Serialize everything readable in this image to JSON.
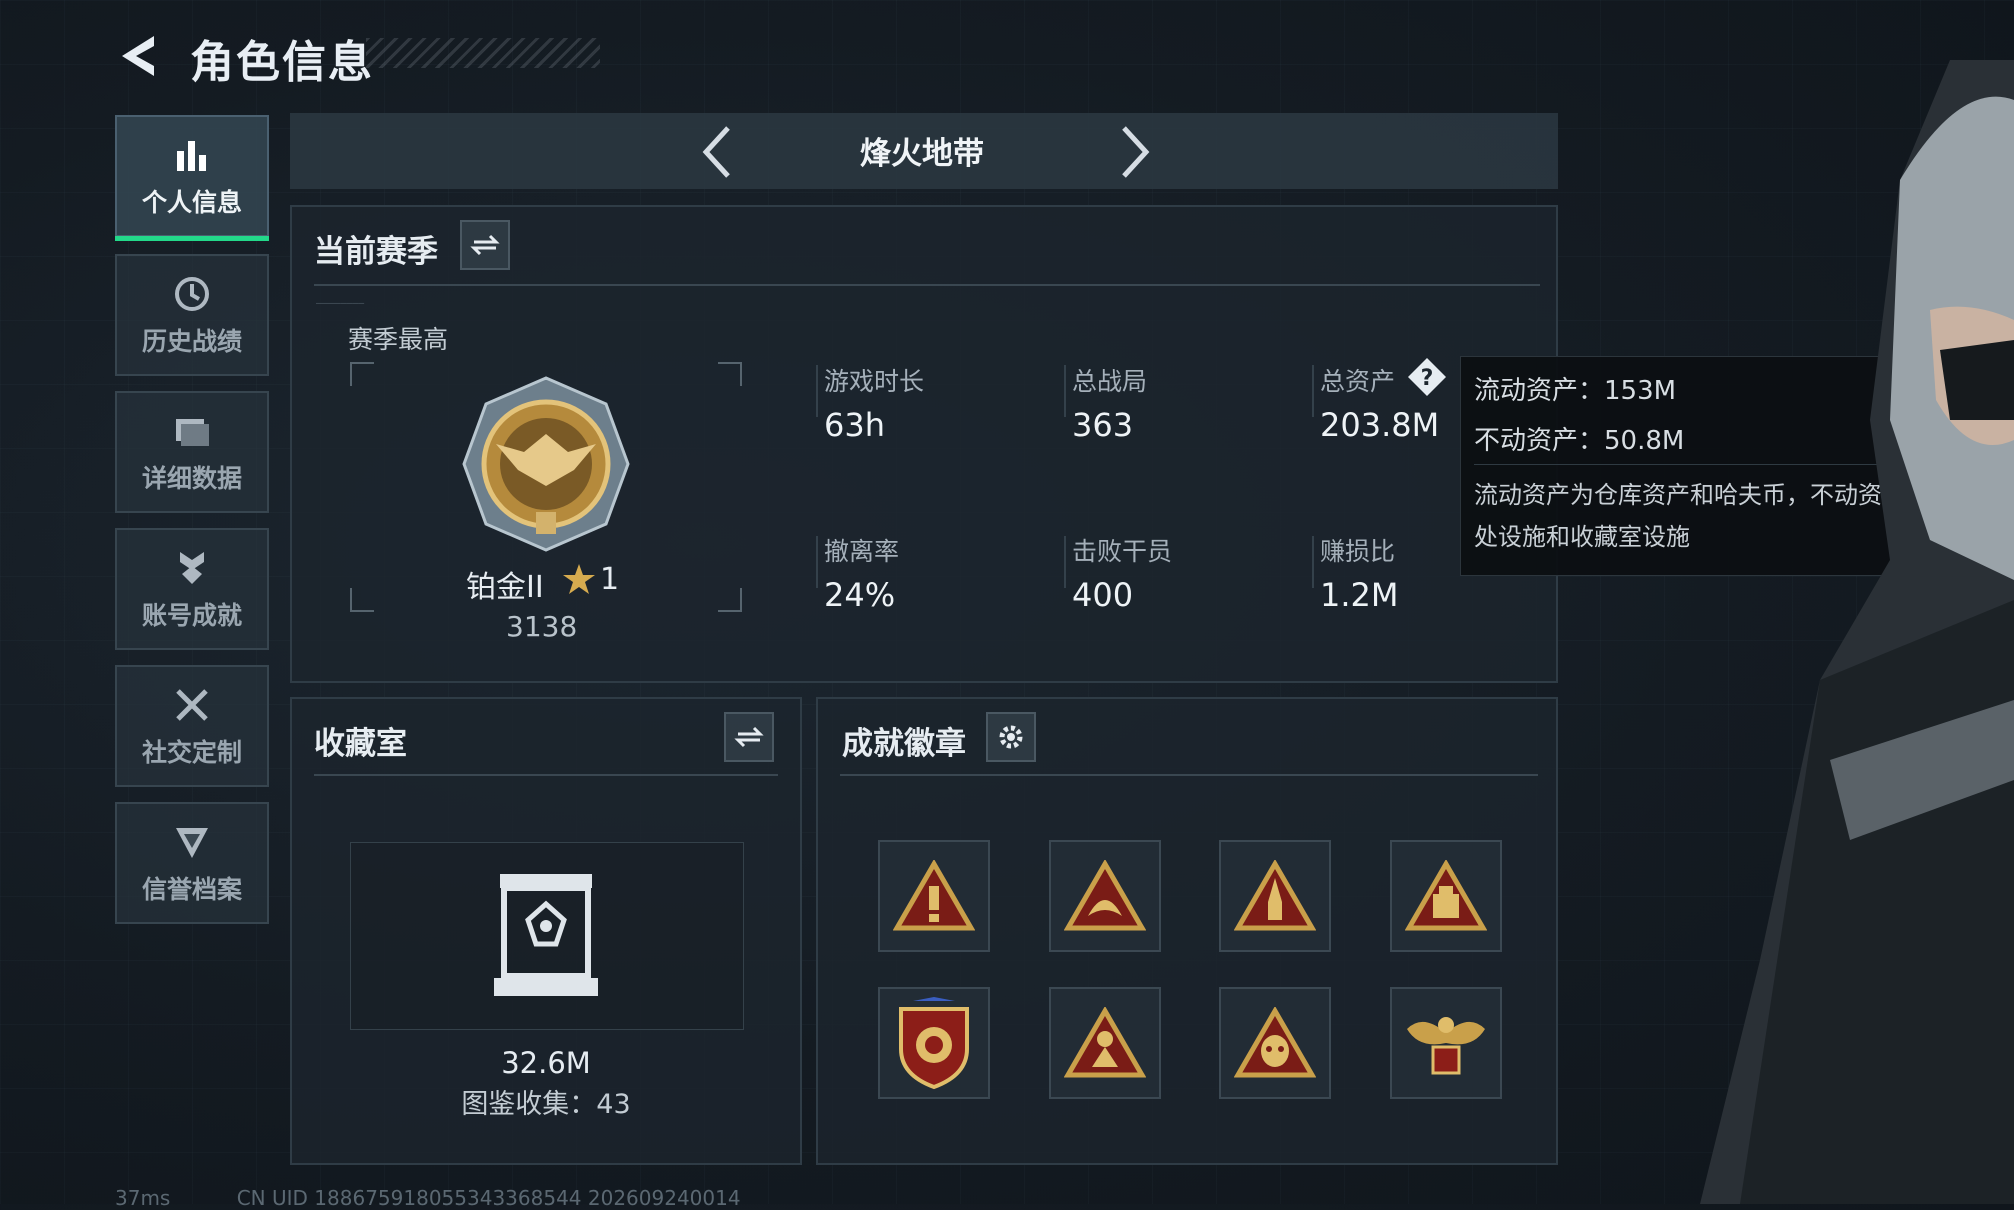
{
  "header": {
    "title": "角色信息"
  },
  "nav": {
    "items": [
      {
        "label": "个人信息",
        "icon": "bar-chart-icon",
        "active": true
      },
      {
        "label": "历史战绩",
        "icon": "clock-icon",
        "active": false
      },
      {
        "label": "详细数据",
        "icon": "folder-icon",
        "active": false
      },
      {
        "label": "账号成就",
        "icon": "medal-icon",
        "active": false
      },
      {
        "label": "社交定制",
        "icon": "tools-icon",
        "active": false
      },
      {
        "label": "信誉档案",
        "icon": "shield-icon",
        "active": false
      }
    ]
  },
  "mode": {
    "title": "烽火地带"
  },
  "season": {
    "title": "当前赛季",
    "best_label": "赛季最高",
    "rank_name": "铂金II",
    "rank_stars": "1",
    "rank_score": "3138",
    "stats": [
      {
        "label": "游戏时长",
        "value": "63h"
      },
      {
        "label": "总战局",
        "value": "363"
      },
      {
        "label": "总资产",
        "value": "203.8M"
      },
      {
        "label": "撤离率",
        "value": "24%"
      },
      {
        "label": "击败干员",
        "value": "400"
      },
      {
        "label": "赚损比",
        "value": "1.2M"
      }
    ]
  },
  "tooltip": {
    "liquid": "流动资产：153M",
    "fixed": "不动资产：50.8M",
    "desc": "流动资产为仓库资产和哈夫币，不动资产为特勤处设施和收藏室设施"
  },
  "collection": {
    "title": "收藏室",
    "value": "32.6M",
    "count_text": "图鉴收集：43"
  },
  "badges": {
    "title": "成就徽章",
    "items": [
      "warning-badge-icon",
      "dragon-badge-icon",
      "rocket-badge-icon",
      "box-badge-icon",
      "lion-shield-badge-icon",
      "soldier-badge-icon",
      "mask-badge-icon",
      "eagle-badge-icon"
    ]
  },
  "status": {
    "ping": "37ms",
    "uid": "CN UID 188675918055343368544 202609240014"
  },
  "colors": {
    "accent": "#23d98a",
    "gold": "#c9a04a",
    "badge_red": "#7a1c16"
  }
}
